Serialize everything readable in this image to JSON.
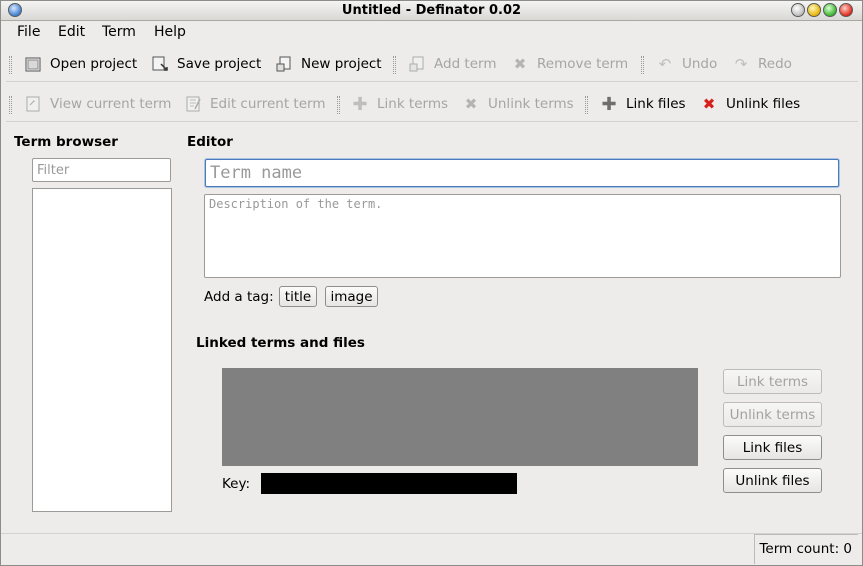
{
  "window": {
    "title": "Untitled - Definator 0.02"
  },
  "menubar": [
    {
      "label": "File"
    },
    {
      "label": "Edit"
    },
    {
      "label": "Term"
    },
    {
      "label": "Help"
    }
  ],
  "toolbar1": {
    "open": "Open project",
    "save": "Save project",
    "new": "New project",
    "add_term": "Add term",
    "remove_term": "Remove term",
    "undo": "Undo",
    "redo": "Redo"
  },
  "toolbar2": {
    "view_term": "View current term",
    "edit_term": "Edit current term",
    "link_terms": "Link terms",
    "unlink_terms": "Unlink terms",
    "link_files": "Link files",
    "unlink_files": "Unlink files"
  },
  "term_browser": {
    "label": "Term browser",
    "filter_placeholder": "Filter"
  },
  "editor": {
    "label": "Editor",
    "term_name_placeholder": "Term name",
    "description_placeholder": "Description of the term.",
    "add_tag_label": "Add a tag:",
    "tag_buttons": [
      "title",
      "image"
    ]
  },
  "linked": {
    "label": "Linked terms and files",
    "key_label": "Key:",
    "buttons": {
      "link_terms": "Link terms",
      "unlink_terms": "Unlink terms",
      "link_files": "Link files",
      "unlink_files": "Unlink files"
    }
  },
  "status": {
    "term_count": "Term count: 0"
  },
  "colors": {
    "graph_area": "#808080",
    "key_bar": "#000000",
    "unlink_icon": "#d8201a"
  }
}
